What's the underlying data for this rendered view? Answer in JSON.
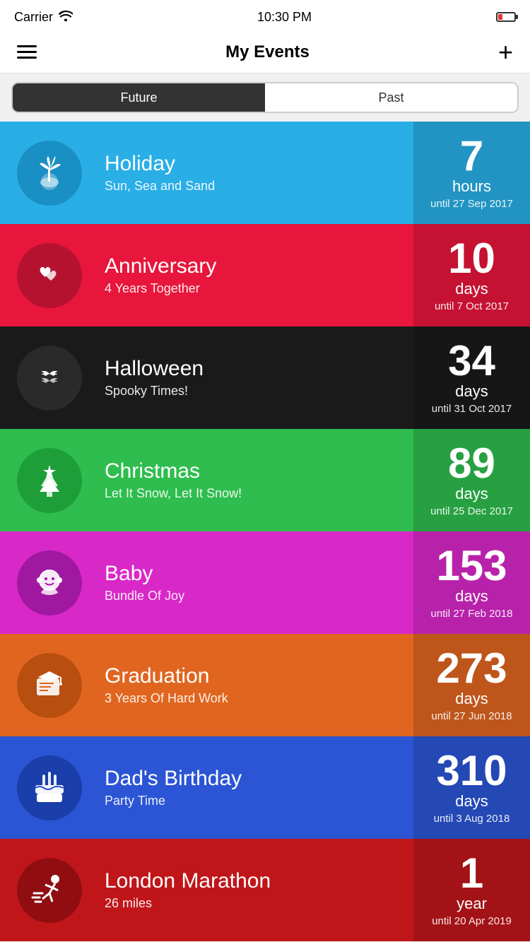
{
  "status": {
    "carrier": "Carrier",
    "wifi": true,
    "time": "10:30 PM",
    "battery_level": 25
  },
  "nav": {
    "title": "My Events",
    "add_label": "+"
  },
  "segments": {
    "future_label": "Future",
    "past_label": "Past",
    "active": "future"
  },
  "events": [
    {
      "id": "holiday",
      "name": "Holiday",
      "subtitle": "Sun, Sea and Sand",
      "countdown_number": "7",
      "countdown_unit": "hours",
      "countdown_until": "until 27 Sep 2017",
      "color": "holiday"
    },
    {
      "id": "anniversary",
      "name": "Anniversary",
      "subtitle": "4 Years Together",
      "countdown_number": "10",
      "countdown_unit": "days",
      "countdown_until": "until 7 Oct 2017",
      "color": "anniversary"
    },
    {
      "id": "halloween",
      "name": "Halloween",
      "subtitle": "Spooky Times!",
      "countdown_number": "34",
      "countdown_unit": "days",
      "countdown_until": "until 31 Oct 2017",
      "color": "halloween"
    },
    {
      "id": "christmas",
      "name": "Christmas",
      "subtitle": "Let It Snow, Let It Snow!",
      "countdown_number": "89",
      "countdown_unit": "days",
      "countdown_until": "until 25 Dec 2017",
      "color": "christmas"
    },
    {
      "id": "baby",
      "name": "Baby",
      "subtitle": "Bundle Of Joy",
      "countdown_number": "153",
      "countdown_unit": "days",
      "countdown_until": "until 27 Feb 2018",
      "color": "baby"
    },
    {
      "id": "graduation",
      "name": "Graduation",
      "subtitle": "3 Years Of Hard Work",
      "countdown_number": "273",
      "countdown_unit": "days",
      "countdown_until": "until 27 Jun 2018",
      "color": "graduation"
    },
    {
      "id": "birthday",
      "name": "Dad's Birthday",
      "subtitle": "Party Time",
      "countdown_number": "310",
      "countdown_unit": "days",
      "countdown_until": "until 3 Aug 2018",
      "color": "birthday"
    },
    {
      "id": "marathon",
      "name": "London Marathon",
      "subtitle": "26 miles",
      "countdown_number": "1",
      "countdown_unit": "year",
      "countdown_until": "until 20 Apr 2019",
      "color": "marathon"
    }
  ]
}
